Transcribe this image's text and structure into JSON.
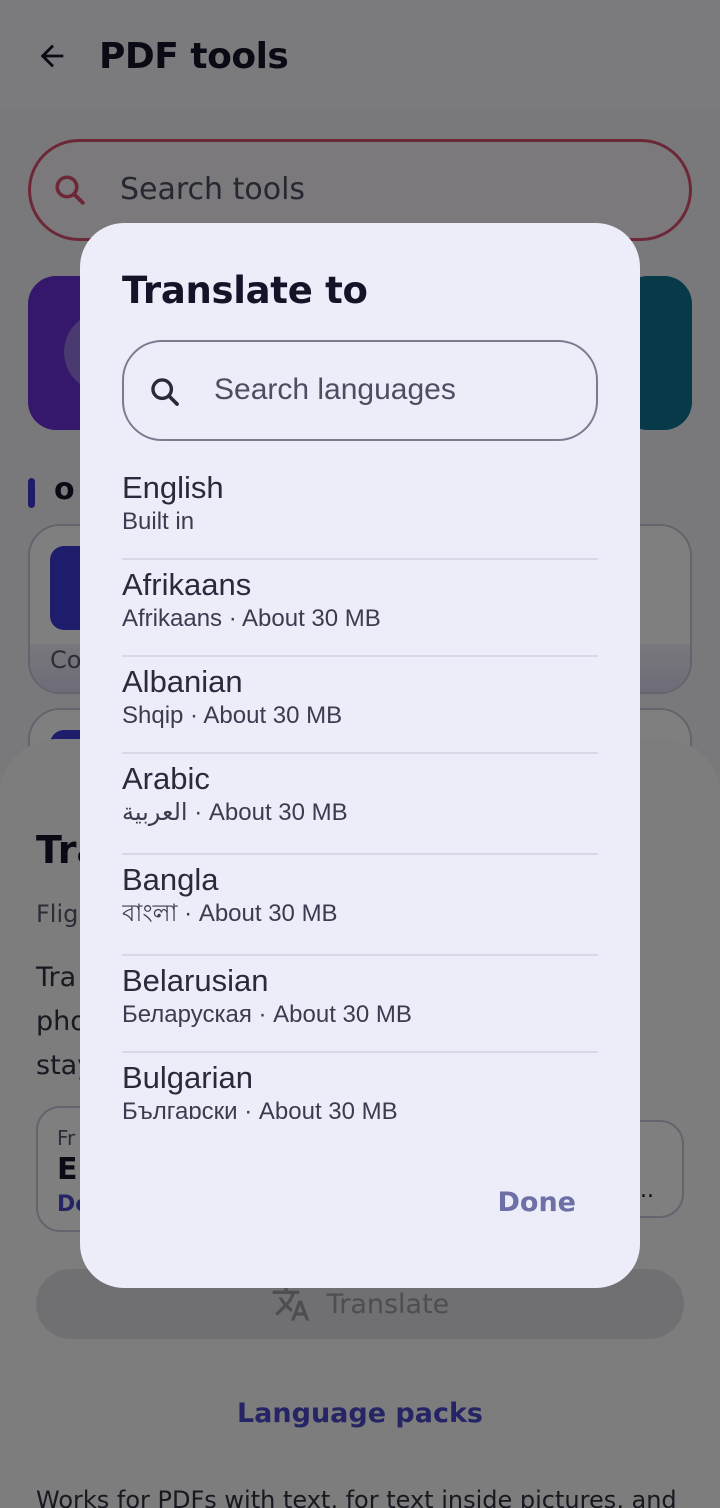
{
  "appbar": {
    "title": "PDF tools"
  },
  "background_search": {
    "placeholder": "Search tools"
  },
  "section": {
    "label_partial": "o"
  },
  "tool_card": {
    "caption_partial": "Co"
  },
  "sheet": {
    "title_partial": "Tra",
    "subtitle_partial": "Flig",
    "desc_lines_partial": [
      "Tra",
      "pho",
      "stay"
    ],
    "from_label_partial": "Fr",
    "from_value_partial": "E",
    "from_link_partial": "De",
    "to_ellipsis": "..",
    "translate_label": "Translate",
    "language_packs": "Language packs",
    "footer_note": "Works for PDFs with text, for text inside pictures, and"
  },
  "dialog": {
    "title": "Translate to",
    "search_placeholder": "Search languages",
    "languages": [
      {
        "name": "English",
        "detail": "Built in"
      },
      {
        "name": "Afrikaans",
        "detail": "Afrikaans · About 30 MB"
      },
      {
        "name": "Albanian",
        "detail": "Shqip · About 30 MB"
      },
      {
        "name": "Arabic",
        "detail": "العربية · About 30 MB"
      },
      {
        "name": "Bangla",
        "detail": "বাংলা · About 30 MB"
      },
      {
        "name": "Belarusian",
        "detail": "Беларуская · About 30 MB"
      },
      {
        "name": "Bulgarian",
        "detail": "Български · About 30 MB"
      }
    ],
    "done_label": "Done"
  },
  "colors": {
    "accent": "#4a48c9",
    "search_border": "#d9506e",
    "dialog_bg": "#ecedf9",
    "done_text": "#6d6fa6"
  }
}
